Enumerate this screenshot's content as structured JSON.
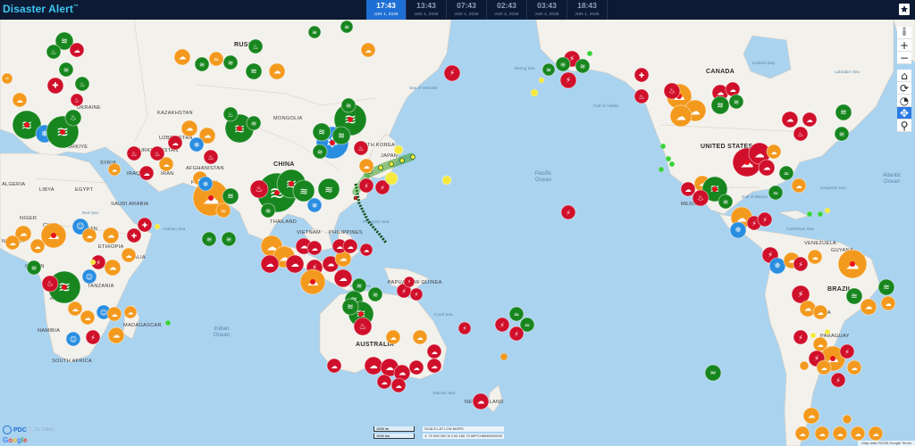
{
  "app": {
    "title": "Disaster Alert",
    "trademark": "™"
  },
  "timeline": [
    {
      "time": "17:43",
      "date": "JUN 1, 2026",
      "active": true
    },
    {
      "time": "13:43",
      "date": "JUN 1, 2026"
    },
    {
      "time": "07:43",
      "date": "JUN 1, 2026"
    },
    {
      "time": "02:43",
      "date": "JUN 2, 2026"
    },
    {
      "time": "03:43",
      "date": "JUN 2, 2026"
    },
    {
      "time": "18:43",
      "date": "JUN 1, 2026"
    }
  ],
  "places": [
    "RUSSIA",
    "CANADA",
    "UNITED STATES",
    "CHINA",
    "AUSTRALIA",
    "BRAZIL",
    "KAZAKHSTAN",
    "MONGOLIA",
    "UKRAINE",
    "TÜRKIYE",
    "SYRIA",
    "IRAQ",
    "IRAN",
    "AFGHANISTAN",
    "PAKISTAN",
    "INDIA",
    "SAUDI ARABIA",
    "EGYPT",
    "LIBYA",
    "ALGERIA",
    "NIGER",
    "CHAD",
    "SUDAN",
    "ETHIOPIA",
    "NIGERIA",
    "GABON",
    "TANZANIA",
    "ANGOLA",
    "NAMIBIA",
    "SOUTH AFRICA",
    "MADAGASCAR",
    "UZBEKISTAN",
    "THAILAND",
    "VIETNAM",
    "PHILIPPINES",
    "JAPAN",
    "SOUTH KOREA",
    "NEW ZEALAND",
    "VENEZUELA",
    "GUYANA",
    "BOLIVIA",
    "PARAGUAY",
    "MEXICO",
    "PAPUA NEW GUINEA",
    "TURKMENISTAN",
    "KENYA",
    "SOMALIA"
  ],
  "oceans": [
    "Pacific Ocean",
    "Atlantic Ocean",
    "Indian Ocean"
  ],
  "seas": [
    "Sea of Okhotsk",
    "Bering Sea",
    "Gulf of Alaska",
    "Hudson Bay",
    "Labrador Sea",
    "Gulf of Mexico",
    "Sargasso Sea",
    "Caribbean Sea",
    "Coral Sea",
    "Tasman Sea",
    "Arabian Sea",
    "Philippine Sea",
    "Banda Sea",
    "Red Sea"
  ],
  "controls": {
    "street_view": "street-view",
    "zoom_in": "+",
    "zoom_out": "−",
    "home": "⌂",
    "refresh": "⟳",
    "history": "◔",
    "locate": "✥",
    "search": "⚲"
  },
  "branding": {
    "org": "PDC",
    "sub": "GLOBAL",
    "google": [
      "G",
      "o",
      "o",
      "g",
      "l",
      "e"
    ]
  },
  "scale": {
    "bar_top": "1000 mi",
    "bar_bottom": "1000 km",
    "labels": [
      "SCALE",
      "LAT",
      "LON",
      "MGRS"
    ],
    "values": [
      "1: 70 000 000",
      "N 0.00",
      "160.79",
      "59PCH8095000000"
    ]
  },
  "attribution": "Map data ©2026 Google  Terms",
  "legend_colors": {
    "red": "#d0102b",
    "green": "#18861f",
    "orange": "#f39a1e",
    "blue": "#2a8ee0",
    "yellow": "#f5e83c",
    "bright_green": "#3ad13a"
  },
  "markers": [
    {
      "cat": "hazard",
      "c": "green",
      "icon": "flood"
    },
    {
      "cat": "hazard",
      "c": "red",
      "icon": "wildfire"
    },
    {
      "cat": "hazard",
      "c": "orange",
      "icon": "storm"
    },
    {
      "cat": "hazard",
      "c": "blue",
      "icon": "cold"
    },
    {
      "cat": "hazard",
      "c": "red",
      "icon": "earthquake"
    },
    {
      "cat": "hazard",
      "c": "green",
      "icon": "volcano"
    }
  ]
}
